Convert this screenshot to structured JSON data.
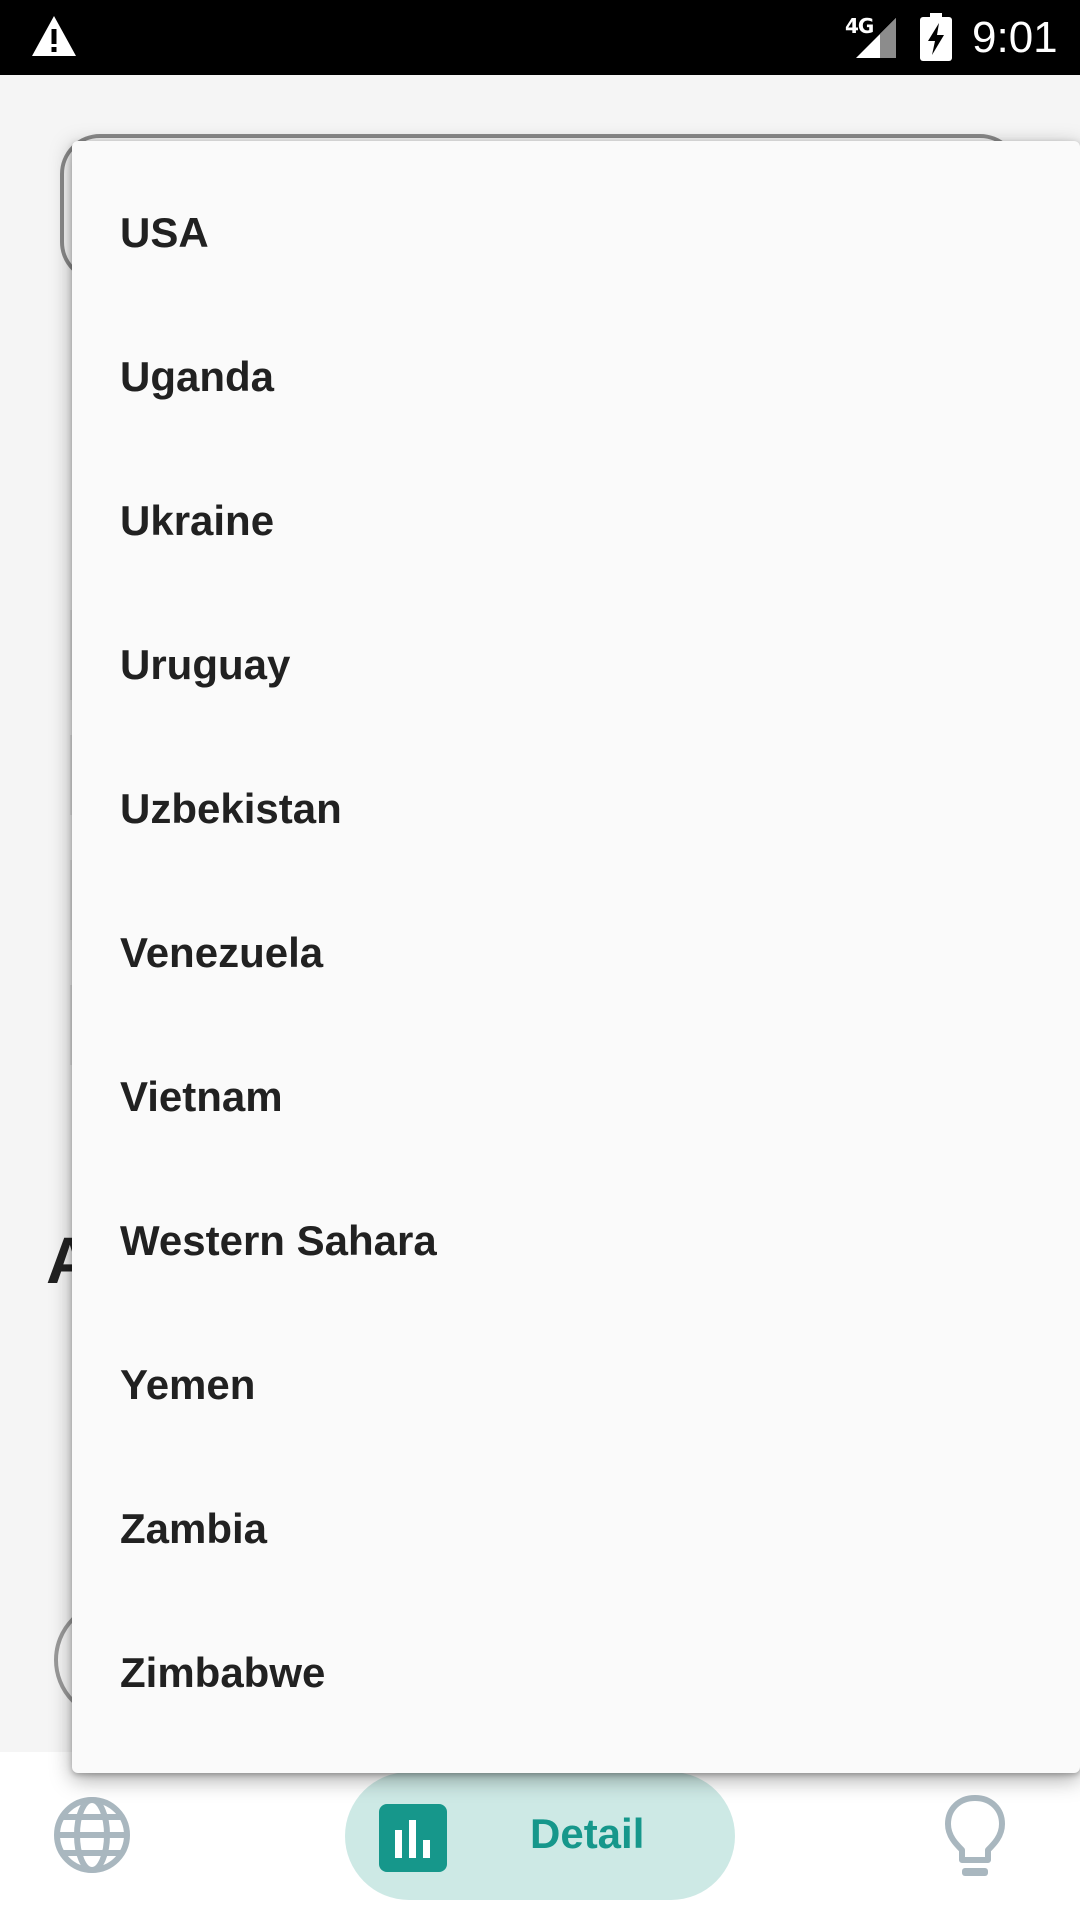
{
  "status_bar": {
    "network": "4G",
    "time": "9:01",
    "icons": [
      "warning-icon",
      "signal-icon",
      "battery-charging-icon"
    ]
  },
  "dropdown": {
    "items": [
      "USA",
      "Uganda",
      "Ukraine",
      "Uruguay",
      "Uzbekistan",
      "Venezuela",
      "Vietnam",
      "Western Sahara",
      "Yemen",
      "Zambia",
      "Zimbabwe"
    ]
  },
  "background": {
    "heading_fragment": "A"
  },
  "bottom_nav": {
    "items": [
      {
        "icon": "globe-icon",
        "label": ""
      },
      {
        "icon": "bar-chart-icon",
        "label": "Detail",
        "selected": true
      },
      {
        "icon": "lightbulb-icon",
        "label": ""
      }
    ],
    "accent_color": "#16978b",
    "selected_bg_color": "#cde9e5"
  }
}
